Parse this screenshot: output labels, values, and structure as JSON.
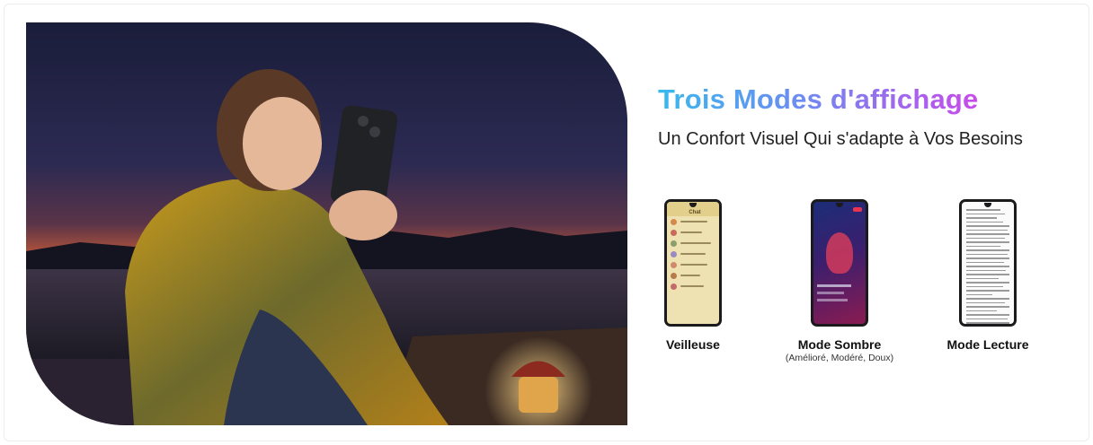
{
  "heading": {
    "title": "Trois Modes d'affichage",
    "subtitle": "Un Confort Visuel Qui s'adapte à Vos Besoins"
  },
  "modes": [
    {
      "label": "Veilleuse",
      "note": ""
    },
    {
      "label": "Mode Sombre",
      "note": "(Amélioré, Modéré, Doux)"
    },
    {
      "label": "Mode Lecture",
      "note": ""
    }
  ],
  "phone_screens": {
    "veilleuse_header": "Chat"
  },
  "colors": {
    "title_gradient_start": "#39b9ee",
    "title_gradient_end": "#c84bea",
    "night_light_screen": "#efe2b2",
    "dark_screen_accent": "#8a1b52"
  }
}
